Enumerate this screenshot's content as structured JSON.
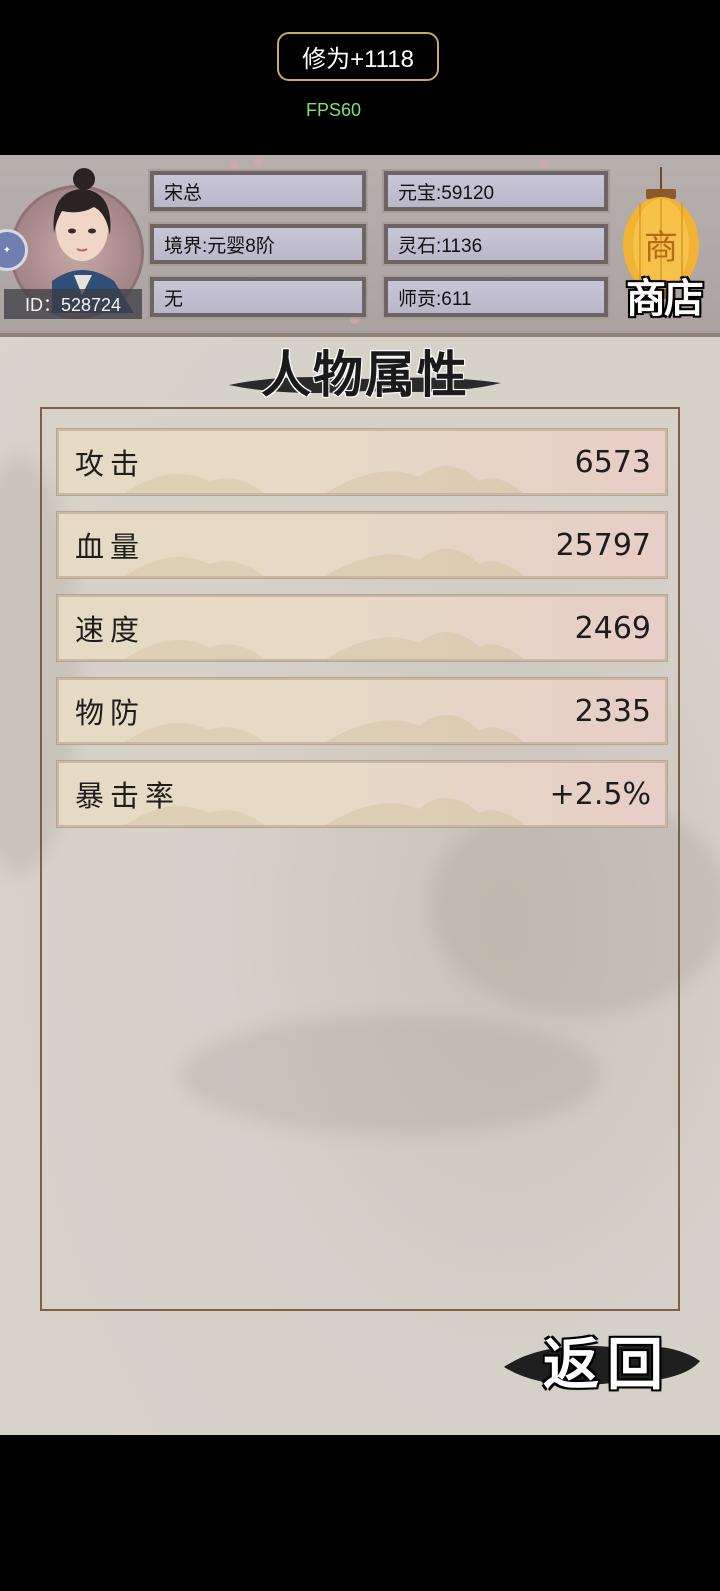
{
  "status_overlay": {
    "cultivation_badge": "修为+1118",
    "fps": "FPS60"
  },
  "header": {
    "player_id": "ID：528724",
    "name": "宋总",
    "realm": "境界:元婴8阶",
    "sect": "无",
    "yuanbao": "元宝:59120",
    "spirit_stone": "灵石:1136",
    "contribution": "师贡:611",
    "shop_label": "商店",
    "lantern_char": "商"
  },
  "title": "人物属性",
  "stats": [
    {
      "label": "攻击",
      "value": "6573"
    },
    {
      "label": "血量",
      "value": "25797"
    },
    {
      "label": "速度",
      "value": "2469"
    },
    {
      "label": "物防",
      "value": "2335"
    },
    {
      "label": "暴击率",
      "value": "+2.5%"
    }
  ],
  "back_label": "返回",
  "colors": {
    "badge_border": "#c9a86a",
    "fps_green": "#7ee07a",
    "panel_border": "#7d5e4c",
    "row_bg": "#e5dbc4"
  }
}
